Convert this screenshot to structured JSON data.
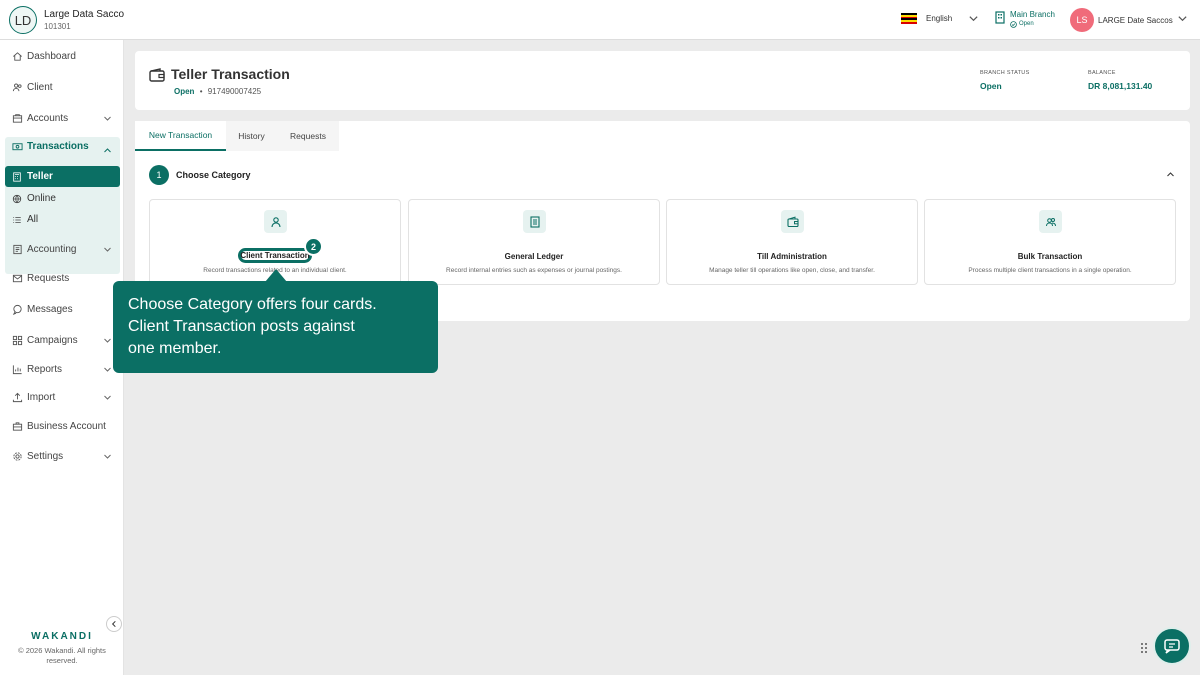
{
  "org": {
    "initials": "LD",
    "name": "Large Data Sacco",
    "code": "101301"
  },
  "topbar": {
    "language": "English",
    "branch": {
      "name": "Main Branch",
      "status": "Open"
    },
    "user": {
      "initials": "LS",
      "name": "LARGE Date Saccos"
    }
  },
  "sidebar": {
    "items": [
      {
        "label": "Dashboard",
        "icon": "home-icon"
      },
      {
        "label": "Client",
        "icon": "users-icon"
      },
      {
        "label": "Accounts",
        "icon": "bank-icon"
      },
      {
        "label": "Transactions",
        "icon": "cash-icon"
      },
      {
        "label": "Accounting",
        "icon": "ledger-icon"
      },
      {
        "label": "Requests",
        "icon": "mail-icon"
      },
      {
        "label": "Messages",
        "icon": "chat-icon"
      },
      {
        "label": "Campaigns",
        "icon": "grid-icon"
      },
      {
        "label": "Reports",
        "icon": "chart-icon"
      },
      {
        "label": "Import",
        "icon": "upload-icon"
      },
      {
        "label": "Business Account",
        "icon": "briefcase-icon"
      },
      {
        "label": "Settings",
        "icon": "gear-icon"
      }
    ],
    "transactions_sub": [
      "Teller",
      "Online",
      "All"
    ],
    "brand": "WAKANDI",
    "copyright": "© 2026 Wakandi. All rights reserved."
  },
  "header": {
    "title": "Teller Transaction",
    "status": "Open",
    "separator": "•",
    "account": "917490007425",
    "branch_status_label": "BRANCH STATUS",
    "branch_status_value": "Open",
    "balance_label": "BALANCE",
    "balance_value": "DR 8,081,131.40"
  },
  "tabs": [
    "New Transaction",
    "History",
    "Requests"
  ],
  "step": {
    "number": "1",
    "title": "Choose Category"
  },
  "categories": [
    {
      "title": "Client Transaction",
      "desc": "Record transactions related to an individual client.",
      "icon": "user-icon"
    },
    {
      "title": "General Ledger",
      "desc": "Record internal entries such as expenses or journal postings.",
      "icon": "document-icon"
    },
    {
      "title": "Till Administration",
      "desc": "Manage teller till operations like open, close, and transfer.",
      "icon": "wallet-icon"
    },
    {
      "title": "Bulk Transaction",
      "desc": "Process multiple client transactions in a single operation.",
      "icon": "group-icon"
    }
  ],
  "guide": {
    "step_number": "2",
    "text": "Choose Category offers four cards. Client Transaction posts against one member."
  },
  "colors": {
    "primary": "#0b6f64",
    "primary_light": "#e6f2f0",
    "avatar": "#f06b7a"
  }
}
